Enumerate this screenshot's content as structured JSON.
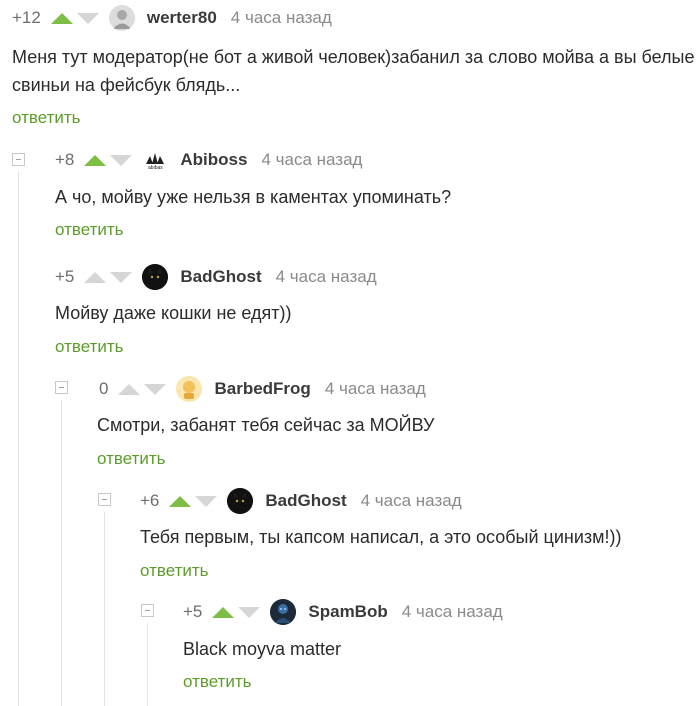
{
  "comments": [
    {
      "rating": "+12",
      "user": "werter80",
      "time": "4 часа назад",
      "text": "Меня тут модератор(не бот а живой человек)забанил за слово мойва а вы белые свиньи на фейсбук блядь...",
      "reply": "ответить",
      "avatar": "grey-portrait-avatar"
    },
    {
      "rating": "+8",
      "user": "Abiboss",
      "time": "4 часа назад",
      "text": "А чо, мойву уже нельзя в каментах упоминать?",
      "reply": "ответить",
      "avatar": "abibas-logo-avatar",
      "avatar_caption": "abibas"
    },
    {
      "rating": "+5",
      "user": "BadGhost",
      "time": "4 часа назад",
      "text": "Мойву даже кошки не едят))",
      "reply": "ответить",
      "avatar": "black-cat-avatar"
    },
    {
      "rating": "0",
      "user": "BarbedFrog",
      "time": "4 часа назад",
      "text": "Смотри, забанят тебя сейчас за МОЙВУ",
      "reply": "ответить",
      "avatar": "yellow-drawing-avatar"
    },
    {
      "rating": "+6",
      "user": "BadGhost",
      "time": "4 часа назад",
      "text": "Тебя первым, ты капсом написал, а это особый цинизм!))",
      "reply": "ответить",
      "avatar": "black-cat-avatar"
    },
    {
      "rating": "+5",
      "user": "SpamBob",
      "time": "4 часа назад",
      "text": "Black moyva matter",
      "reply": "ответить",
      "avatar": "dark-figure-avatar"
    }
  ],
  "colors": {
    "upvote": "#7fbe45",
    "reply": "#5d9c2b",
    "inactive_arrow": "#d6d6d6"
  }
}
